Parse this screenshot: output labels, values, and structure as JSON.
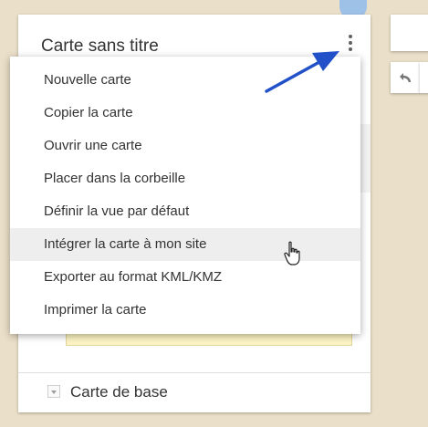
{
  "panel": {
    "title": "Carte sans titre"
  },
  "menu": {
    "items": [
      "Nouvelle carte",
      "Copier la carte",
      "Ouvrir une carte",
      "Placer dans la corbeille",
      "Définir la vue par défaut",
      "Intégrer la carte à mon site",
      "Exporter au format KML/KMZ",
      "Imprimer la carte"
    ],
    "hovered_item": "Intégrer la carte à mon site"
  },
  "base_layer": {
    "label": "Carte de base"
  },
  "icons": {
    "menu_button": "more-vert-icon",
    "annotation": "arrow-icon",
    "cursor": "hand-pointer-icon",
    "undo": "undo-icon",
    "base_toggle": "chevron-down-icon"
  },
  "colors": {
    "annotation_arrow": "#2150c8",
    "menu_hover": "#eeeeee",
    "map_background": "#eadfc8",
    "water": "#9ec1e8"
  }
}
